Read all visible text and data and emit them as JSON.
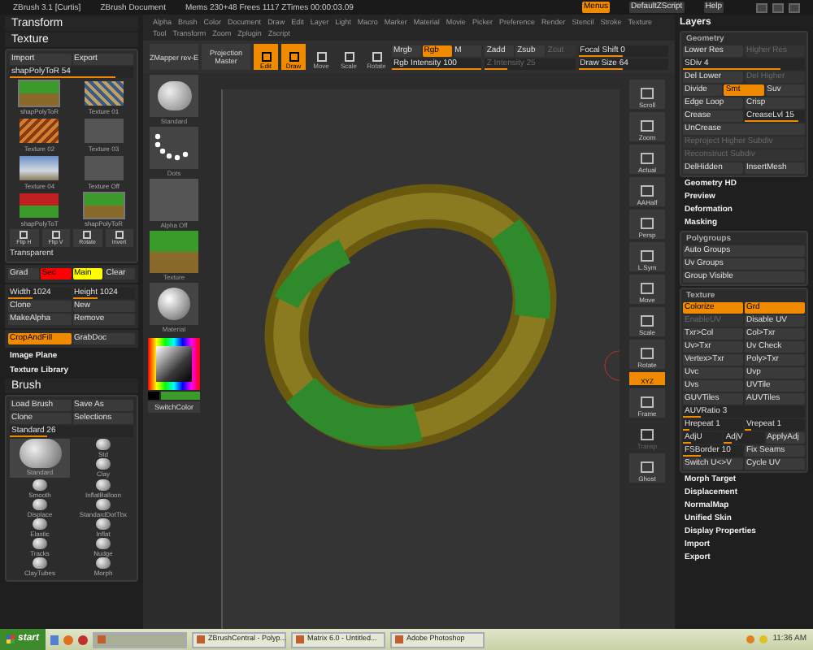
{
  "title_bar": [
    "ZBrush 3.1 [Curtis]",
    "ZBrush Document",
    "Mems 230+48 Frees 1117 ZTimes 00:00:03.09"
  ],
  "header_buttons": [
    {
      "kind": "toggle",
      "label": "Menus",
      "on": true
    },
    {
      "kind": "button",
      "label": "DefaultZScript"
    },
    {
      "kind": "button",
      "label": "Help"
    }
  ],
  "menus": [
    [
      "Alpha",
      "Brush",
      "Color",
      "Document",
      "Draw",
      "Edit",
      "Layer",
      "Light",
      "Macro",
      "Marker",
      "Material",
      "Movie",
      "Picker",
      "Preference",
      "Render",
      "Stencil",
      "Stroke",
      "Texture"
    ],
    [
      "Tool",
      "Transform",
      "Zoom",
      "Zplugin",
      "Zscript"
    ]
  ],
  "toolbar": {
    "plugins": [
      "ZMapper rev-E",
      "Projection Master"
    ],
    "modes": [
      {
        "label": "Edit",
        "on": true
      },
      {
        "label": "Draw",
        "on": true
      },
      {
        "label": "Move",
        "on": false
      },
      {
        "label": "Scale",
        "on": false
      },
      {
        "label": "Rotate",
        "on": false
      }
    ],
    "groups": [
      {
        "top": [
          {
            "kind": "button",
            "label": "Mrgb"
          },
          {
            "kind": "toggle",
            "label": "Rgb",
            "on": true
          },
          {
            "kind": "button",
            "label": "M"
          }
        ],
        "bottom": {
          "kind": "slider",
          "label": "Rgb Intensity 100",
          "level": 1
        }
      },
      {
        "top": [
          {
            "kind": "button",
            "label": "Zadd"
          },
          {
            "kind": "button",
            "label": "Zsub"
          },
          {
            "kind": "dim",
            "label": "Zcut"
          }
        ],
        "bottom": {
          "kind": "dimslider",
          "label": "Z Intensity 25",
          "level": 0.25
        }
      },
      {
        "top": [
          {
            "kind": "slider",
            "label": "Focal Shift 0",
            "level": 0.5
          }
        ],
        "bottom": {
          "kind": "slider",
          "label": "Draw Size 64",
          "level": 0.5
        }
      }
    ]
  },
  "left_panel": {
    "headings": [
      "Transform",
      "Texture"
    ],
    "rows_top": [
      [
        {
          "kind": "button",
          "label": "Import"
        },
        {
          "kind": "button",
          "label": "Export"
        }
      ],
      [
        {
          "kind": "slider",
          "label": "shapPolyToR 54",
          "level": 0.85
        }
      ]
    ],
    "thumbs": [
      {
        "kind": "grass",
        "label": "shapPolyToR",
        "selected": true
      },
      {
        "kind": "pattern",
        "label": "Texture 01",
        "selected": false
      },
      {
        "kind": "rust",
        "label": "Texture 02",
        "selected": false
      },
      {
        "kind": "blank",
        "label": "Texture 03",
        "selected": false
      },
      {
        "kind": "sky",
        "label": "Texture 04",
        "selected": false
      },
      {
        "kind": "blank",
        "label": "Texture Off",
        "selected": false
      },
      {
        "kind": "flag",
        "label": "shapPolyToT",
        "selected": false
      },
      {
        "kind": "grass",
        "label": "shapPolyToR",
        "selected": true
      }
    ],
    "tools": [
      "Flip H",
      "Flip V",
      "Rotate",
      "Invert"
    ],
    "transparent": "Transparent",
    "swatches": [
      {
        "kind": "button",
        "label": "Grad"
      },
      {
        "kind": "swatch",
        "label": "Sec",
        "color": "#ff0000"
      },
      {
        "kind": "swatch",
        "label": "Main",
        "color": "#ffff00"
      },
      {
        "kind": "button",
        "label": "Clear"
      }
    ],
    "rows_mid": [
      [
        {
          "kind": "slider",
          "label": "Width 1024",
          "level": 0.4
        },
        {
          "kind": "slider",
          "label": "Height 1024",
          "level": 0.4
        }
      ],
      [
        {
          "kind": "button",
          "label": "Clone"
        },
        {
          "kind": "button",
          "label": "New"
        }
      ],
      [
        {
          "kind": "button",
          "label": "MakeAlpha"
        },
        {
          "kind": "button",
          "label": "Remove"
        }
      ]
    ],
    "crop": [
      {
        "kind": "toggle",
        "label": "CropAndFill",
        "on": true
      },
      {
        "kind": "button",
        "label": "GrabDoc"
      }
    ],
    "subheadings": [
      "Image Plane",
      "Texture Library"
    ],
    "brush_heading": "Brush",
    "brush_rows": [
      [
        {
          "kind": "button",
          "label": "Load Brush"
        },
        {
          "kind": "button",
          "label": "Save As"
        }
      ],
      [
        {
          "kind": "button",
          "label": "Clone"
        },
        {
          "kind": "button",
          "label": "Selections"
        }
      ],
      [
        {
          "kind": "slider",
          "label": "Standard 26",
          "level": 0.3
        }
      ]
    ],
    "current_brush": "Standard",
    "brushes": [
      "Std",
      "Clay",
      "Smooth",
      "InflatBalloon",
      "Displace",
      "StandardDotTbx",
      "Elastic",
      "Inflat",
      "Tracks",
      "Nudge",
      "ClayTubes",
      "Morph"
    ]
  },
  "left_shelf": {
    "items": [
      {
        "kind": "brush",
        "label": "Standard"
      },
      {
        "kind": "dots",
        "label": "Dots"
      },
      {
        "kind": "blank",
        "label": "Alpha Off"
      },
      {
        "kind": "grass",
        "label": "Texture"
      },
      {
        "kind": "sphere",
        "label": "Material"
      }
    ],
    "switch": "SwitchColor"
  },
  "right_shelf": [
    {
      "kind": "button",
      "label": "Scroll"
    },
    {
      "kind": "button",
      "label": "Zoom"
    },
    {
      "kind": "button",
      "label": "Actual"
    },
    {
      "kind": "button",
      "label": "AAHalf"
    },
    {
      "kind": "button",
      "label": "Persp"
    },
    {
      "kind": "button",
      "label": "L.Sym"
    },
    {
      "kind": "button",
      "label": "Move"
    },
    {
      "kind": "button",
      "label": "Scale"
    },
    {
      "kind": "button",
      "label": "Rotate"
    },
    {
      "kind": "toggle",
      "label": "XYZ",
      "on": true
    },
    {
      "kind": "button",
      "label": "Frame"
    },
    {
      "kind": "dim",
      "label": "Transp"
    },
    {
      "kind": "button",
      "label": "Ghost"
    }
  ],
  "right_panel": {
    "title": "Layers",
    "sections": [
      {
        "kind": "group",
        "title": "Geometry",
        "rows": [
          [
            {
              "kind": "button",
              "label": "Lower Res"
            },
            {
              "kind": "dim",
              "label": "Higher Res"
            }
          ],
          [
            {
              "kind": "slider",
              "label": "SDiv 4",
              "level": 0.8
            }
          ],
          [
            {
              "kind": "button",
              "label": "Del Lower"
            },
            {
              "kind": "dim",
              "label": "Del Higher"
            }
          ],
          [
            {
              "kind": "button",
              "label": "Divide"
            },
            {
              "kind": "toggle",
              "label": "Smt",
              "on": true
            },
            {
              "kind": "toggle",
              "label": "Suv",
              "on": false
            }
          ],
          [
            {
              "kind": "button",
              "label": "Edge Loop"
            },
            {
              "kind": "button",
              "label": "Crisp"
            }
          ],
          [
            {
              "kind": "button",
              "label": "Crease"
            },
            {
              "kind": "slider",
              "label": "CreaseLvl 15",
              "level": 0.9
            }
          ],
          [
            {
              "kind": "button",
              "label": "UnCrease"
            }
          ],
          [
            {
              "kind": "dim",
              "label": "Reproject Higher Subdiv"
            }
          ],
          [
            {
              "kind": "dim",
              "label": "Reconstruct Subdiv"
            }
          ],
          [
            {
              "kind": "button",
              "label": "DelHidden"
            },
            {
              "kind": "button",
              "label": "InsertMesh"
            }
          ]
        ]
      },
      {
        "kind": "heading",
        "title": "Geometry HD"
      },
      {
        "kind": "heading",
        "title": "Preview"
      },
      {
        "kind": "heading",
        "title": "Deformation"
      },
      {
        "kind": "heading",
        "title": "Masking"
      },
      {
        "kind": "group",
        "title": "Polygroups",
        "rows": [
          [
            {
              "kind": "button",
              "label": "Auto Groups"
            }
          ],
          [
            {
              "kind": "button",
              "label": "Uv Groups"
            }
          ],
          [
            {
              "kind": "button",
              "label": "Group Visible"
            }
          ]
        ]
      },
      {
        "kind": "group",
        "title": "Texture",
        "rows": [
          [
            {
              "kind": "toggle",
              "label": "Colorize",
              "on": true
            },
            {
              "kind": "toggle",
              "label": "Grd",
              "on": true
            }
          ],
          [
            {
              "kind": "dim",
              "label": "EnableUV"
            },
            {
              "kind": "button",
              "label": "Disable UV"
            }
          ],
          [
            {
              "kind": "button",
              "label": "Txr>Col"
            },
            {
              "kind": "button",
              "label": "Col>Txr"
            }
          ],
          [
            {
              "kind": "button",
              "label": "Uv>Txr"
            },
            {
              "kind": "button",
              "label": "Uv Check"
            }
          ],
          [
            {
              "kind": "button",
              "label": "Vertex>Txr"
            },
            {
              "kind": "button",
              "label": "Poly>Txr"
            }
          ],
          [
            {
              "kind": "button",
              "label": "Uvc"
            },
            {
              "kind": "button",
              "label": "Uvp"
            }
          ],
          [
            {
              "kind": "button",
              "label": "Uvs"
            },
            {
              "kind": "button",
              "label": "UVTile"
            }
          ],
          [
            {
              "kind": "button",
              "label": "GUVTiles"
            },
            {
              "kind": "button",
              "label": "AUVTiles"
            }
          ],
          [
            {
              "kind": "slider",
              "label": "AUVRatio 3",
              "level": 0.15
            }
          ],
          [
            {
              "kind": "slider",
              "label": "Hrepeat 1",
              "level": 0.1
            },
            {
              "kind": "slider",
              "label": "Vrepeat 1",
              "level": 0.1
            }
          ],
          [
            {
              "kind": "slider",
              "label": "AdjU",
              "level": 0.2
            },
            {
              "kind": "slider",
              "label": "AdjV",
              "level": 0.2
            },
            {
              "kind": "button",
              "label": "ApplyAdj"
            }
          ],
          [
            {
              "kind": "slider",
              "label": "FSBorder 10",
              "level": 0.3
            },
            {
              "kind": "button",
              "label": "Fix Seams"
            }
          ],
          [
            {
              "kind": "button",
              "label": "Switch U<>V"
            },
            {
              "kind": "button",
              "label": "Cycle UV"
            }
          ]
        ]
      },
      {
        "kind": "heading",
        "title": "Morph Target"
      },
      {
        "kind": "heading",
        "title": "Displacement"
      },
      {
        "kind": "heading",
        "title": "NormalMap"
      },
      {
        "kind": "heading",
        "title": "Unified Skin"
      },
      {
        "kind": "heading",
        "title": "Display Properties"
      },
      {
        "kind": "heading",
        "title": "Import"
      },
      {
        "kind": "heading",
        "title": "Export"
      }
    ]
  },
  "taskbar": {
    "start": "start",
    "tasks": [
      {
        "selected": true
      },
      {
        "label": "ZBrushCentral - Polyp...",
        "selected": false
      },
      {
        "label": "Matrix 6.0 - Untitled...",
        "selected": false
      },
      {
        "label": "Adobe Photoshop",
        "selected": false
      }
    ],
    "clock": "11:36 AM"
  }
}
